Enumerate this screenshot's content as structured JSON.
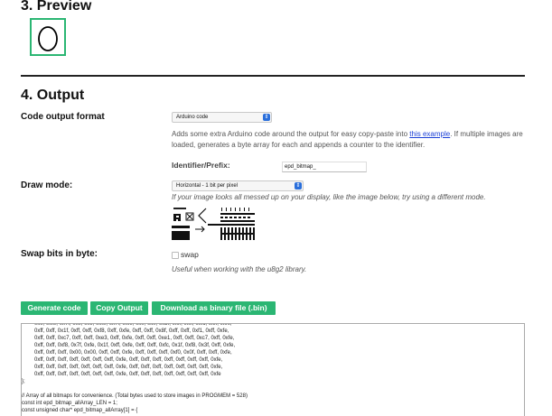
{
  "preview": {
    "heading": "3. Preview"
  },
  "output": {
    "heading": "4. Output",
    "code_format": {
      "label": "Code output format",
      "selected": "Arduino code",
      "help_before": "Adds some extra Arduino code around the output for easy copy-paste into ",
      "help_link": "this example",
      "help_after": ". If multiple images are loaded, generates a byte array for each and appends a counter to the identifier."
    },
    "identifier": {
      "label": "Identifier/Prefix:",
      "value": "epd_bitmap_"
    },
    "draw_mode": {
      "label": "Draw mode:",
      "selected": "Horizontal - 1 bit per pixel",
      "help": "If your image looks all messed up on your display, like the image below, try using a different mode."
    },
    "swap_bits": {
      "label": "Swap bits in byte:",
      "option": "swap",
      "checked": false,
      "help": "Useful when working with the u8g2 library."
    },
    "buttons": {
      "generate": "Generate code",
      "copy": "Copy Output",
      "download": "Download as binary file (.bin)"
    },
    "code_lines": [
      "0xff, 0xfe, 0x7f, 0xff, 0xff, 0xfe, 0x7f, 0xfe, 0xff, 0xff, 0x3f, 0xff, 0xff, 0xfc, 0xff, 0xfe,",
      "0xff, 0xff, 0x1f, 0xff, 0xff, 0xf8, 0xff, 0xfe, 0xff, 0xff, 0x8f, 0xff, 0xff, 0xf1, 0xff, 0xfe,",
      "0xff, 0xff, 0xc7, 0xff, 0xff, 0xe3, 0xff, 0xfe, 0xff, 0xff, 0xe1, 0xff, 0xff, 0xc7, 0xff, 0xfe,",
      "0xff, 0xff, 0xf8, 0x7f, 0xfe, 0x1f, 0xff, 0xfe, 0xff, 0xff, 0xfc, 0x1f, 0xf8, 0x3f, 0xff, 0xfe,",
      "0xff, 0xff, 0xff, 0x00, 0x00, 0xff, 0xff, 0xfe, 0xff, 0xff, 0xff, 0xf0, 0x0f, 0xff, 0xff, 0xfe,",
      "0xff, 0xff, 0xff, 0xff, 0xff, 0xff, 0xff, 0xfe, 0xff, 0xff, 0xff, 0xff, 0xff, 0xff, 0xff, 0xfe,",
      "0xff, 0xff, 0xff, 0xff, 0xff, 0xff, 0xff, 0xfe, 0xff, 0xff, 0xff, 0xff, 0xff, 0xff, 0xff, 0xfe,",
      "0xff, 0xff, 0xff, 0xff, 0xff, 0xff, 0xff, 0xfe, 0xff, 0xff, 0xff, 0xff, 0xff, 0xff, 0xff, 0xfe"
    ],
    "code_tail": [
      "};",
      "",
      "// Array of all bitmaps for convenience. (Total bytes used to store images in PROGMEM = 528)",
      "const int epd_bitmap_allArray_LEN = 1;",
      "const unsigned char* epd_bitmap_allArray[1] = {"
    ]
  },
  "colors": {
    "accent": "#2bb673",
    "link": "#1a3fd6",
    "select_arrow": "#2a6fdb"
  }
}
